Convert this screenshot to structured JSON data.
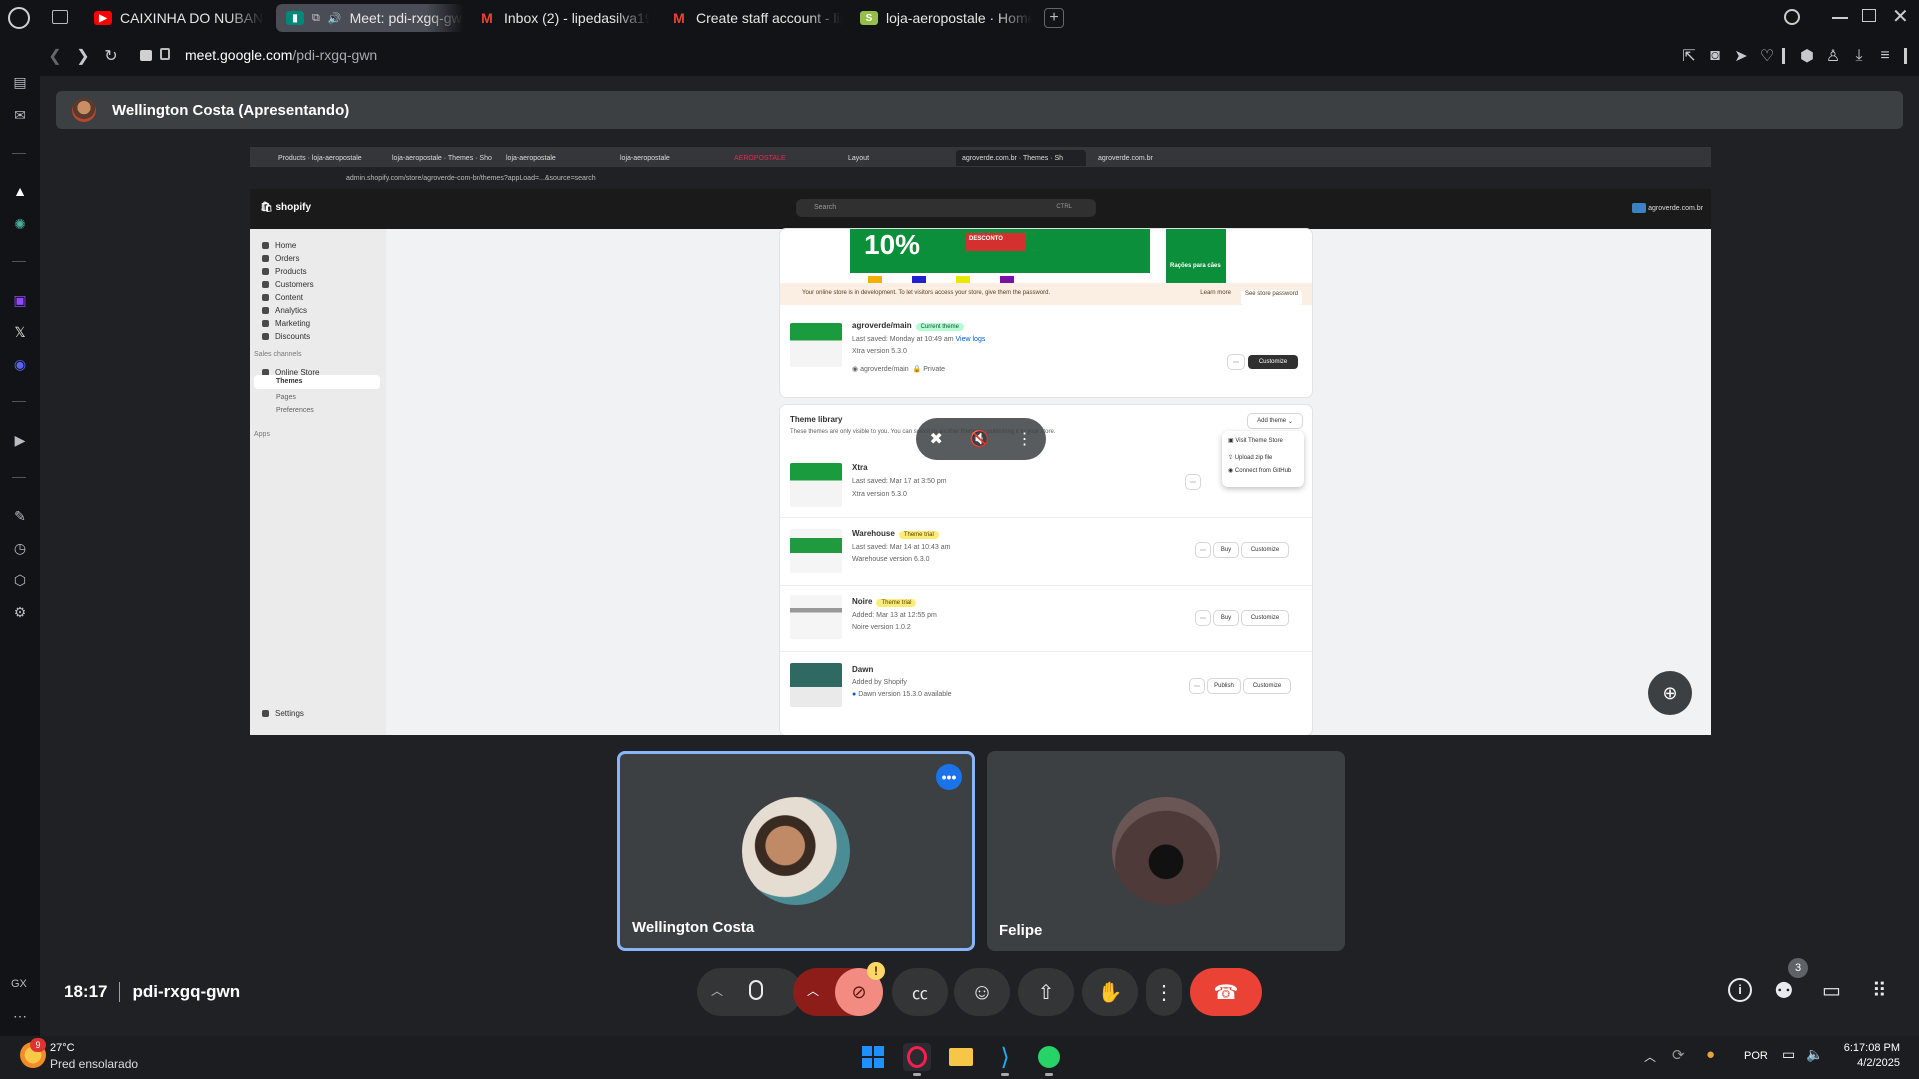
{
  "browser": {
    "tabs": [
      {
        "label": "CAIXINHA DO NUBANK V",
        "icon": "youtube-icon"
      },
      {
        "label": "Meet: pdi-rxgq-gw",
        "icon": "meet-icon",
        "active": true
      },
      {
        "label": "Inbox (2) - lipedasilva1910",
        "icon": "gmail-icon"
      },
      {
        "label": "Create staff account - lip",
        "icon": "gmail-icon"
      },
      {
        "label": "loja-aeropostale · Home ·",
        "icon": "shopify-icon"
      }
    ],
    "url_host": "meet.google.com",
    "url_path": "/pdi-rxgq-gwn"
  },
  "meet": {
    "presenter_label": "Wellington Costa (Apresentando)",
    "time": "18:17",
    "meeting_code": "pdi-rxgq-gwn",
    "participant_count": "3",
    "camera_warning": "!",
    "participants": [
      {
        "name": "Wellington Costa",
        "speaking": true
      },
      {
        "name": "Felipe",
        "speaking": false
      }
    ]
  },
  "shared_screen": {
    "tabs": [
      "Products · loja-aeropostale",
      "loja-aeropostale · Themes · Sho",
      "loja-aeropostale",
      "loja-aeropostale",
      "AEROPOSTALE",
      "Layout",
      "agroverde.com.br · Themes · Sh",
      "agroverde.com.br"
    ],
    "url": "admin.shopify.com/store/agroverde-com-br/themes?appLoad=...&source=search",
    "brand": "shopify",
    "search_placeholder": "Search",
    "search_shortcut": "CTRL",
    "store_name": "agroverde.com.br",
    "nav": [
      "Home",
      "Orders",
      "Products",
      "Customers",
      "Content",
      "Analytics",
      "Marketing",
      "Discounts"
    ],
    "sales_channels": "Sales channels",
    "online_store": "Online Store",
    "online_store_sub": [
      "Themes",
      "Pages",
      "Preferences"
    ],
    "apps": "Apps",
    "settings": "Settings",
    "banner_promo_big": "10%",
    "banner_promo_small": "DESCONTO",
    "banner_side": "Rações para cães",
    "notice": "Your online store is in development. To let visitors access your store, give them the password.",
    "notice_learn": "Learn more",
    "notice_btn": "See store password",
    "current_theme": {
      "name": "agroverde/main",
      "badge": "Current theme",
      "saved": "Last saved: Monday at 10:49 am",
      "view_logs": "View logs",
      "version": "Xtra version 5.3.0",
      "repo": "agroverde/main",
      "visibility": "Private",
      "customize": "Customize"
    },
    "library_title": "Theme library",
    "library_desc": "These themes are only visible to you. You can switch to another theme by publishing it to your store.",
    "add_theme": "Add theme",
    "add_theme_menu": [
      "Visit Theme Store",
      "Upload zip file",
      "Connect from GitHub"
    ],
    "themes": [
      {
        "name": "Xtra",
        "badge": "",
        "line1": "Last saved: Mar 17 at 3:50 pm",
        "line2": "Xtra version 5.3.0",
        "actions": [
          "Publish",
          "Customize"
        ]
      },
      {
        "name": "Warehouse",
        "badge": "Theme trial",
        "line1": "Last saved: Mar 14 at 10:43 am",
        "line2": "Warehouse version 6.3.0",
        "actions": [
          "Buy",
          "Customize"
        ]
      },
      {
        "name": "Noire",
        "badge": "Theme trial",
        "line1": "Added: Mar 13 at 12:55 pm",
        "line2": "Noire version 1.0.2",
        "actions": [
          "Buy",
          "Customize"
        ]
      },
      {
        "name": "Dawn",
        "badge": "",
        "line1": "Added by Shopify",
        "line2": "Dawn version 15.3.0 available",
        "actions": [
          "Publish",
          "Customize"
        ]
      }
    ]
  },
  "taskbar": {
    "weather_temp": "27°C",
    "weather_desc": "Pred ensolarado",
    "weather_badge": "9",
    "language": "POR",
    "clock_time": "6:17:08 PM",
    "clock_date": "4/2/2025"
  },
  "sidebar": {
    "gx_label": "GX"
  },
  "colors": {
    "meet_bg": "#202124",
    "end_call": "#ea4335",
    "speaking_border": "#8ab4f8",
    "camera_off": "#f28b82"
  }
}
